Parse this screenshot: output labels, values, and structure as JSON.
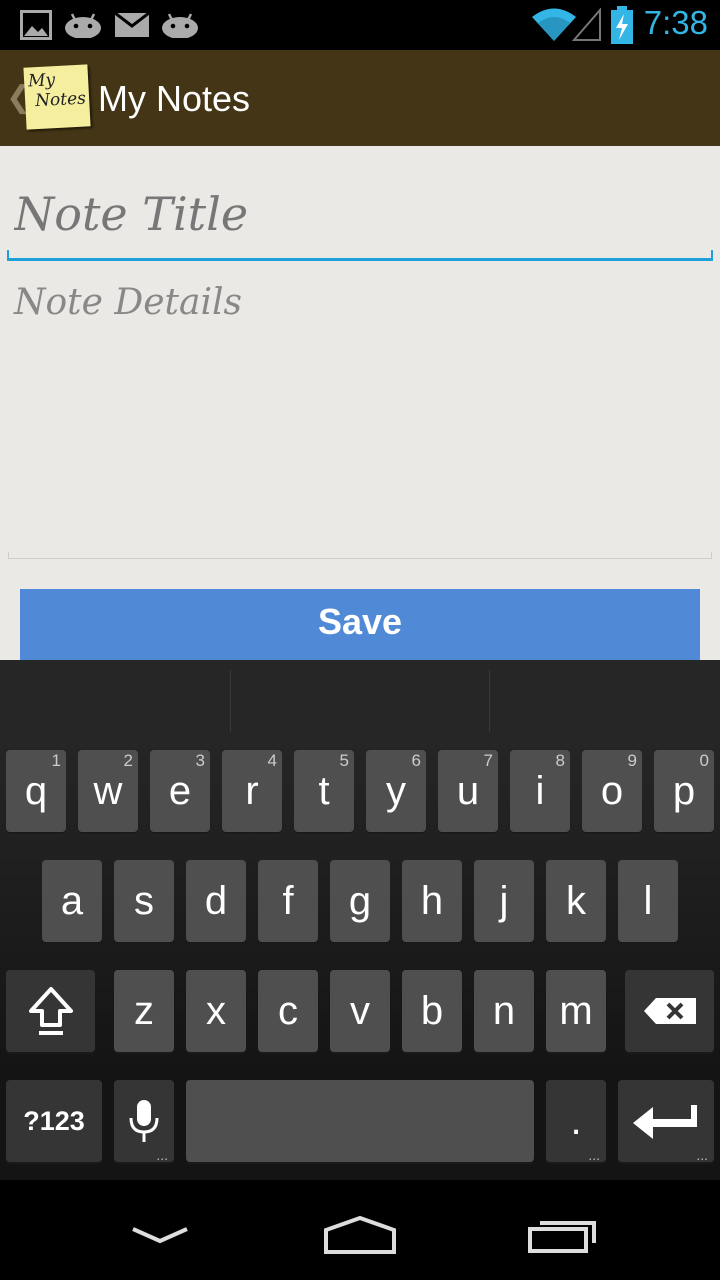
{
  "status_bar": {
    "time": "7:38",
    "icons": [
      "image-icon",
      "android-icon",
      "mail-icon",
      "android-icon",
      "wifi-icon",
      "signal-icon",
      "battery-charging-icon"
    ],
    "accent_color": "#33b5e5"
  },
  "action_bar": {
    "up_glyph": "❮",
    "logo_line1": "My",
    "logo_line2": "Notes",
    "title": "My Notes",
    "background": "#433515"
  },
  "form": {
    "title_placeholder": "Note Title",
    "details_placeholder": "Note Details",
    "save_label": "Save",
    "save_color": "#5089d6"
  },
  "keyboard": {
    "row1": [
      {
        "key": "q",
        "hint": "1"
      },
      {
        "key": "w",
        "hint": "2"
      },
      {
        "key": "e",
        "hint": "3"
      },
      {
        "key": "r",
        "hint": "4"
      },
      {
        "key": "t",
        "hint": "5"
      },
      {
        "key": "y",
        "hint": "6"
      },
      {
        "key": "u",
        "hint": "7"
      },
      {
        "key": "i",
        "hint": "8"
      },
      {
        "key": "o",
        "hint": "9"
      },
      {
        "key": "p",
        "hint": "0"
      }
    ],
    "row2": [
      "a",
      "s",
      "d",
      "f",
      "g",
      "h",
      "j",
      "k",
      "l"
    ],
    "row3": [
      "z",
      "x",
      "c",
      "v",
      "b",
      "n",
      "m"
    ],
    "symbols_label": "?123",
    "period": ".",
    "more_dots": "..."
  },
  "nav_bar": {
    "buttons": [
      "back-icon",
      "home-icon",
      "recents-icon"
    ]
  }
}
